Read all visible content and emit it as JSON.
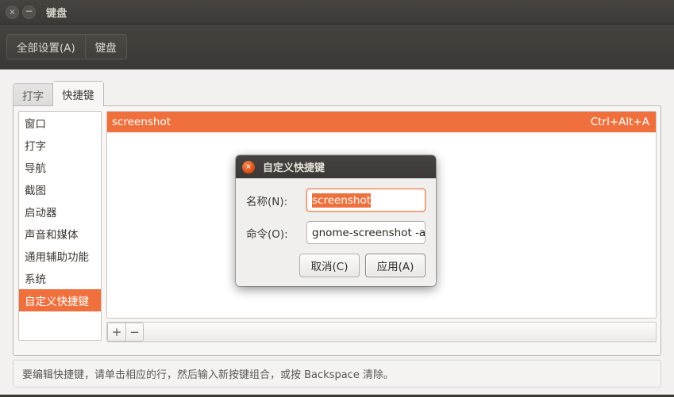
{
  "window": {
    "title": "键盘",
    "close_icon": "close-icon",
    "minimize_icon": "minimize-icon",
    "close_glyph": "×",
    "minimize_glyph": "−"
  },
  "toolbar": {
    "all_settings_label": "全部设置(A)",
    "keyboard_label": "键盘"
  },
  "tabs": [
    {
      "label": "打字",
      "active": false
    },
    {
      "label": "快捷键",
      "active": true
    }
  ],
  "sidebar": {
    "items": [
      {
        "label": "窗口",
        "selected": false
      },
      {
        "label": "打字",
        "selected": false
      },
      {
        "label": "导航",
        "selected": false
      },
      {
        "label": "截图",
        "selected": false
      },
      {
        "label": "启动器",
        "selected": false
      },
      {
        "label": "声音和媒体",
        "selected": false
      },
      {
        "label": "通用辅助功能",
        "selected": false
      },
      {
        "label": "系统",
        "selected": false
      },
      {
        "label": "自定义快捷键",
        "selected": true
      }
    ]
  },
  "shortcut_list": {
    "rows": [
      {
        "name": "screenshot",
        "accel": "Ctrl+Alt+A",
        "selected": true
      }
    ]
  },
  "list_toolbar": {
    "add_label": "+",
    "remove_label": "−",
    "add_icon": "plus-icon",
    "remove_icon": "minus-icon"
  },
  "hint": {
    "text": "要编辑快捷键，请单击相应的行，然后输入新按键组合，或按 Backspace 清除。"
  },
  "dialog": {
    "title": "自定义快捷键",
    "close_glyph": "×",
    "name_label": "名称(N):",
    "name_value": "screenshot",
    "command_label": "命令(O):",
    "command_value": "gnome-screenshot -a",
    "cancel_label": "取消(C)",
    "apply_label": "应用(A)"
  },
  "colors": {
    "accent_orange": "#ef703d",
    "close_red": "#dd4814",
    "titlebar_dark": "#3b3935",
    "panel_bg": "#f7f6f5"
  }
}
